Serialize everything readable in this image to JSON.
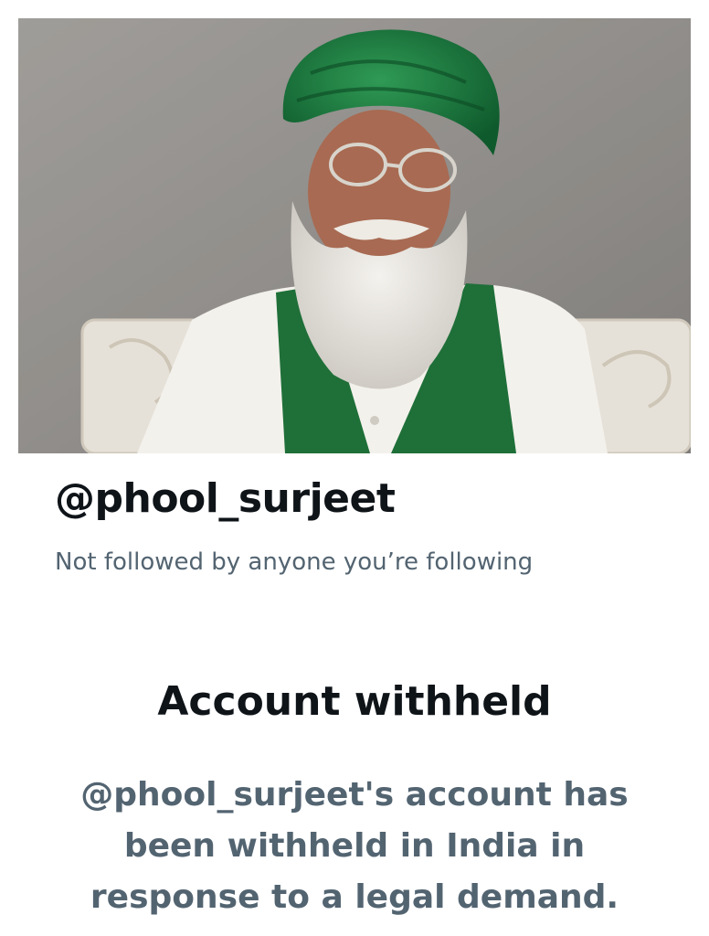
{
  "profile": {
    "banner_alt": "Profile photo: elderly man with white beard, green turban and green vest",
    "handle": "@phool_surjeet",
    "follow_note": "Not followed by anyone you’re following"
  },
  "notice": {
    "title": "Account withheld",
    "message": "@phool_surjeet's account has been withheld in India in response to a legal demand."
  },
  "colors": {
    "primary_text": "#0f1419",
    "secondary_text": "#536471",
    "background": "#ffffff"
  }
}
